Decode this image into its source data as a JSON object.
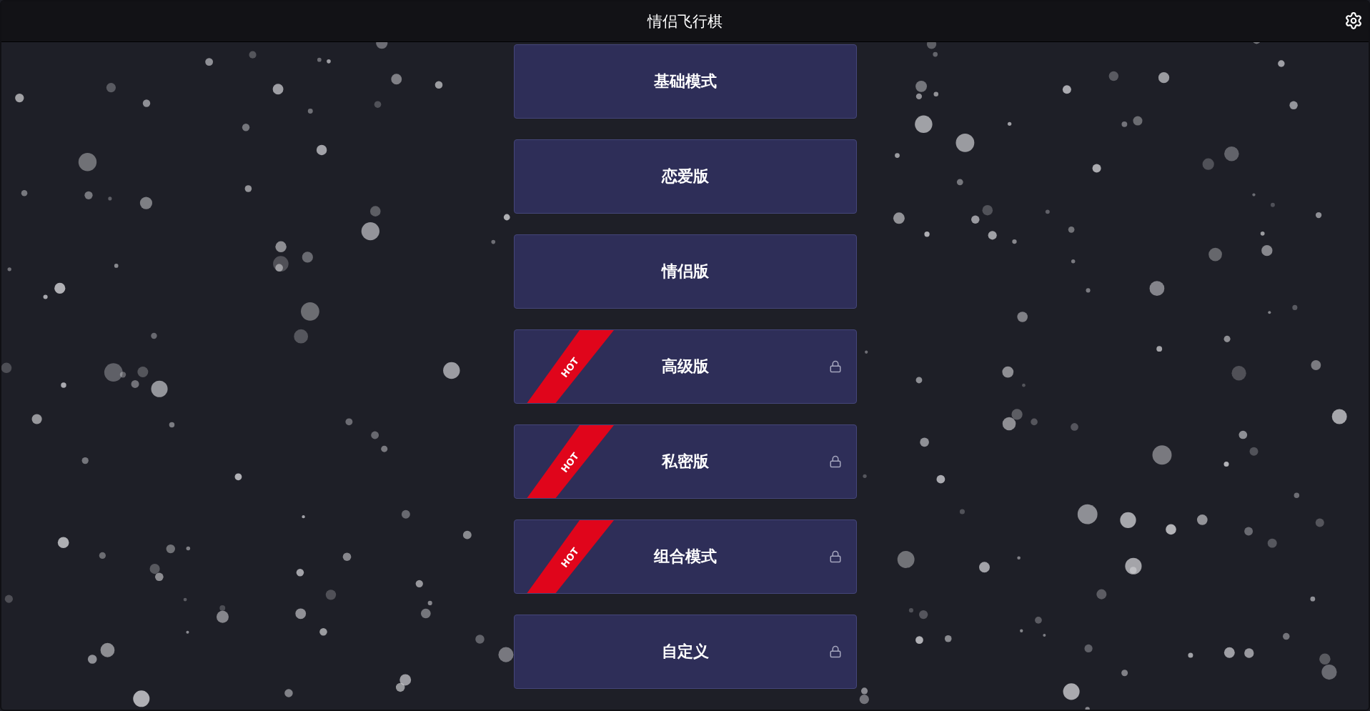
{
  "header": {
    "title": "情侣飞行棋"
  },
  "modes": [
    {
      "label": "基础模式",
      "hot": false,
      "locked": false
    },
    {
      "label": "恋爱版",
      "hot": false,
      "locked": false
    },
    {
      "label": "情侣版",
      "hot": false,
      "locked": false
    },
    {
      "label": "高级版",
      "hot": true,
      "badge": "HOT",
      "locked": true
    },
    {
      "label": "私密版",
      "hot": true,
      "badge": "HOT",
      "locked": true
    },
    {
      "label": "组合模式",
      "hot": true,
      "badge": "HOT",
      "locked": true
    },
    {
      "label": "自定义",
      "hot": false,
      "locked": true
    }
  ]
}
